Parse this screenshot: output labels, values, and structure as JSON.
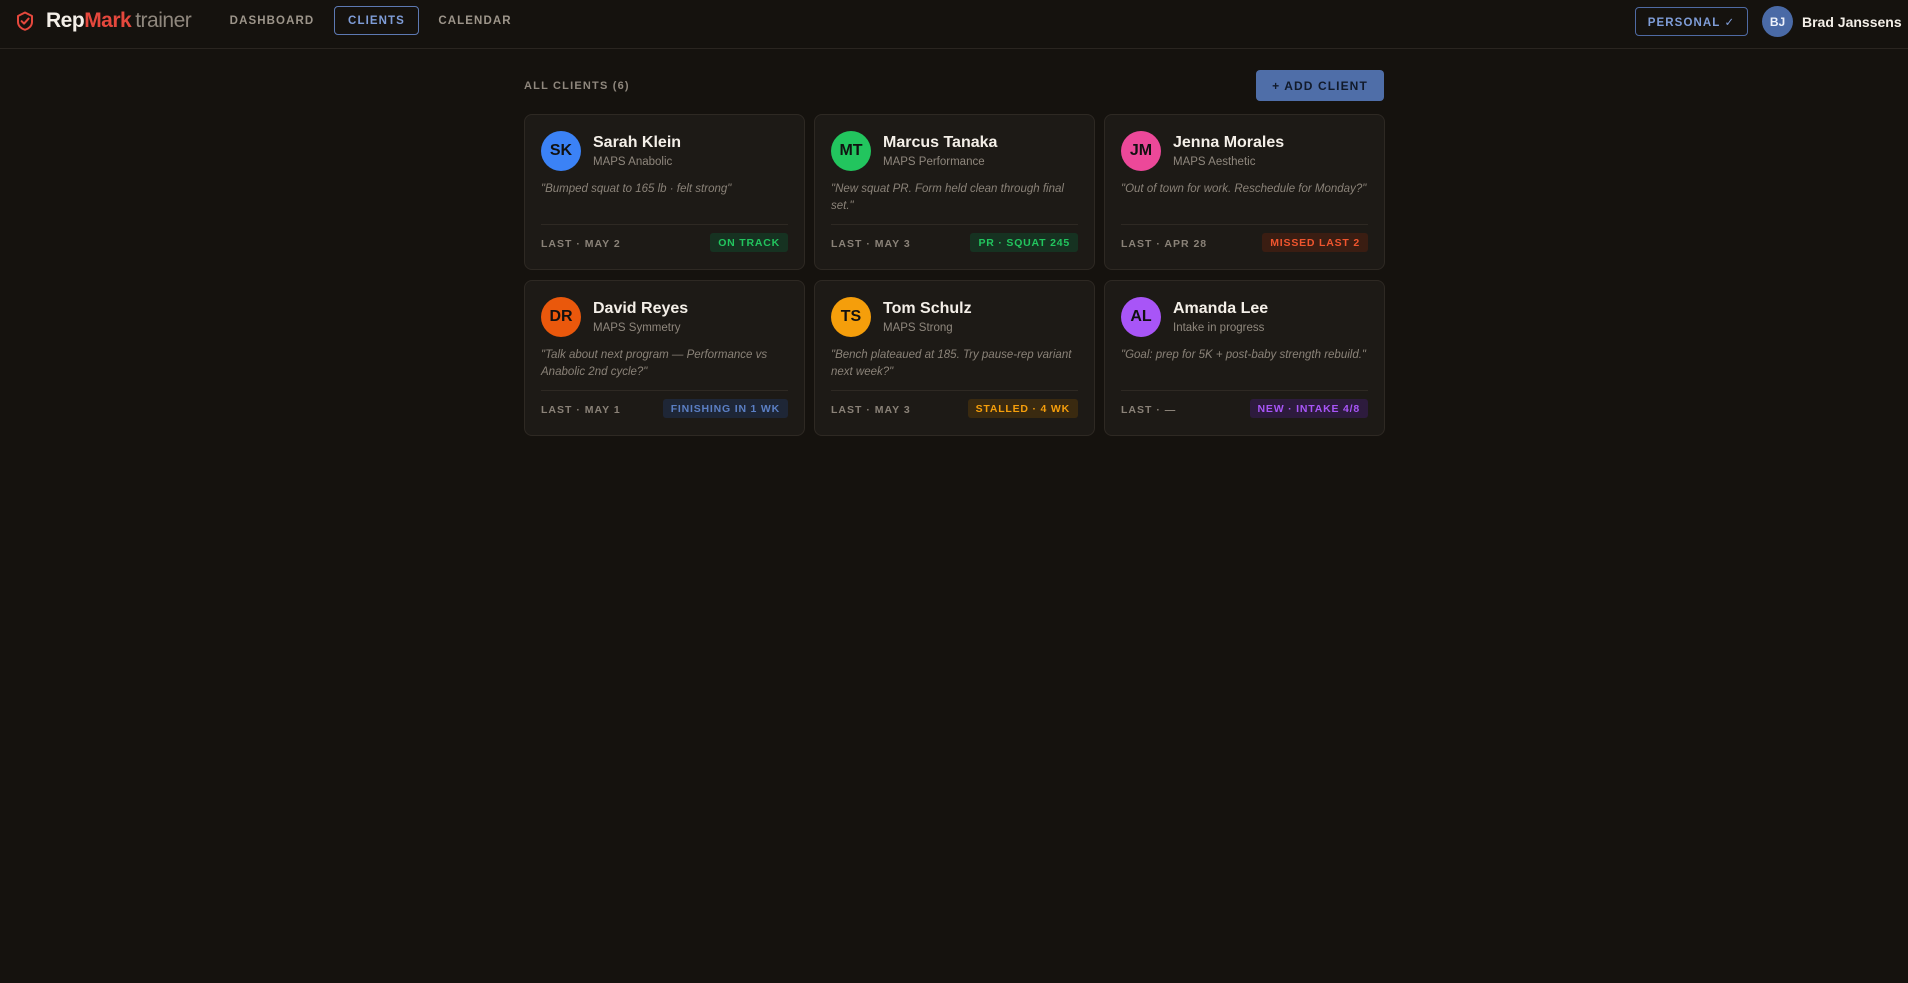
{
  "header": {
    "brand": {
      "rep": "Rep",
      "mark": "Mark",
      "sub": "trainer"
    },
    "nav": [
      {
        "label": "DASHBOARD",
        "active": false
      },
      {
        "label": "CLIENTS",
        "active": true
      },
      {
        "label": "CALENDAR",
        "active": false
      }
    ],
    "mode_pill": "PERSONAL ✓",
    "user": {
      "initials": "BJ",
      "name": "Brad Janssens"
    }
  },
  "main": {
    "section_title": "ALL CLIENTS (6)",
    "add_button": "+ ADD CLIENT",
    "clients": [
      {
        "initials": "SK",
        "avatar_color": "#3b82f6",
        "name": "Sarah Klein",
        "program": "MAPS Anabolic",
        "note": "\"Bumped squat to 165 lb · felt strong\"",
        "last": "LAST · MAY 2",
        "badge": "ON TRACK",
        "badge_fg": "#22c55e",
        "badge_bg": "#163221"
      },
      {
        "initials": "MT",
        "avatar_color": "#22c55e",
        "name": "Marcus Tanaka",
        "program": "MAPS Performance",
        "note": "\"New squat PR. Form held clean through final set.\"",
        "last": "LAST · MAY 3",
        "badge": "PR · SQUAT 245",
        "badge_fg": "#22c55e",
        "badge_bg": "#163221"
      },
      {
        "initials": "JM",
        "avatar_color": "#ec4899",
        "name": "Jenna Morales",
        "program": "MAPS Aesthetic",
        "note": "\"Out of town for work. Reschedule for Monday?\"",
        "last": "LAST · APR 28",
        "badge": "MISSED LAST 2",
        "badge_fg": "#f0552e",
        "badge_bg": "#3a1d12"
      },
      {
        "initials": "DR",
        "avatar_color": "#ea580c",
        "name": "David Reyes",
        "program": "MAPS Symmetry",
        "note": "\"Talk about next program — Performance vs Anabolic 2nd cycle?\"",
        "last": "LAST · MAY 1",
        "badge": "FINISHING IN 1 WK",
        "badge_fg": "#5b7fc4",
        "badge_bg": "#1e2636"
      },
      {
        "initials": "TS",
        "avatar_color": "#f59e0b",
        "name": "Tom Schulz",
        "program": "MAPS Strong",
        "note": "\"Bench plateaued at 185. Try pause-rep variant next week?\"",
        "last": "LAST · MAY 3",
        "badge": "STALLED · 4 WK",
        "badge_fg": "#f59e0b",
        "badge_bg": "#3a2a10"
      },
      {
        "initials": "AL",
        "avatar_color": "#a855f7",
        "name": "Amanda Lee",
        "program": "Intake in progress",
        "note": "\"Goal: prep for 5K + post-baby strength rebuild.\"",
        "last": "LAST · —",
        "badge": "NEW · INTAKE 4/8",
        "badge_fg": "#a855f7",
        "badge_bg": "#2d1b3d"
      }
    ]
  },
  "colors": {
    "background": "#15120e",
    "card": "#1d1a16",
    "accent_blue": "#4f6ea8",
    "brand_red": "#e5483d"
  },
  "icons": {
    "logo": "shield-check-icon"
  }
}
